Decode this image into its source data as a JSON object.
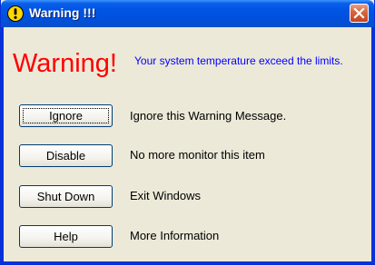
{
  "window": {
    "title": "Warning !!!",
    "close_label": "Close"
  },
  "headline": {
    "big_text": "Warning!",
    "message": "Your system temperature exceed the limits."
  },
  "actions": [
    {
      "label": "Ignore",
      "description": "Ignore this Warning Message."
    },
    {
      "label": "Disable",
      "description": "No more monitor this item"
    },
    {
      "label": "Shut Down",
      "description": "Exit Windows"
    },
    {
      "label": "Help",
      "description": "More Information"
    }
  ],
  "colors": {
    "title_bar": "#0055e5",
    "warning_red": "#ff0000",
    "message_blue": "#0000ff",
    "window_bg": "#ece9d8"
  },
  "icons": {
    "title": "warning-exclamation-icon",
    "close": "close-x-icon"
  }
}
